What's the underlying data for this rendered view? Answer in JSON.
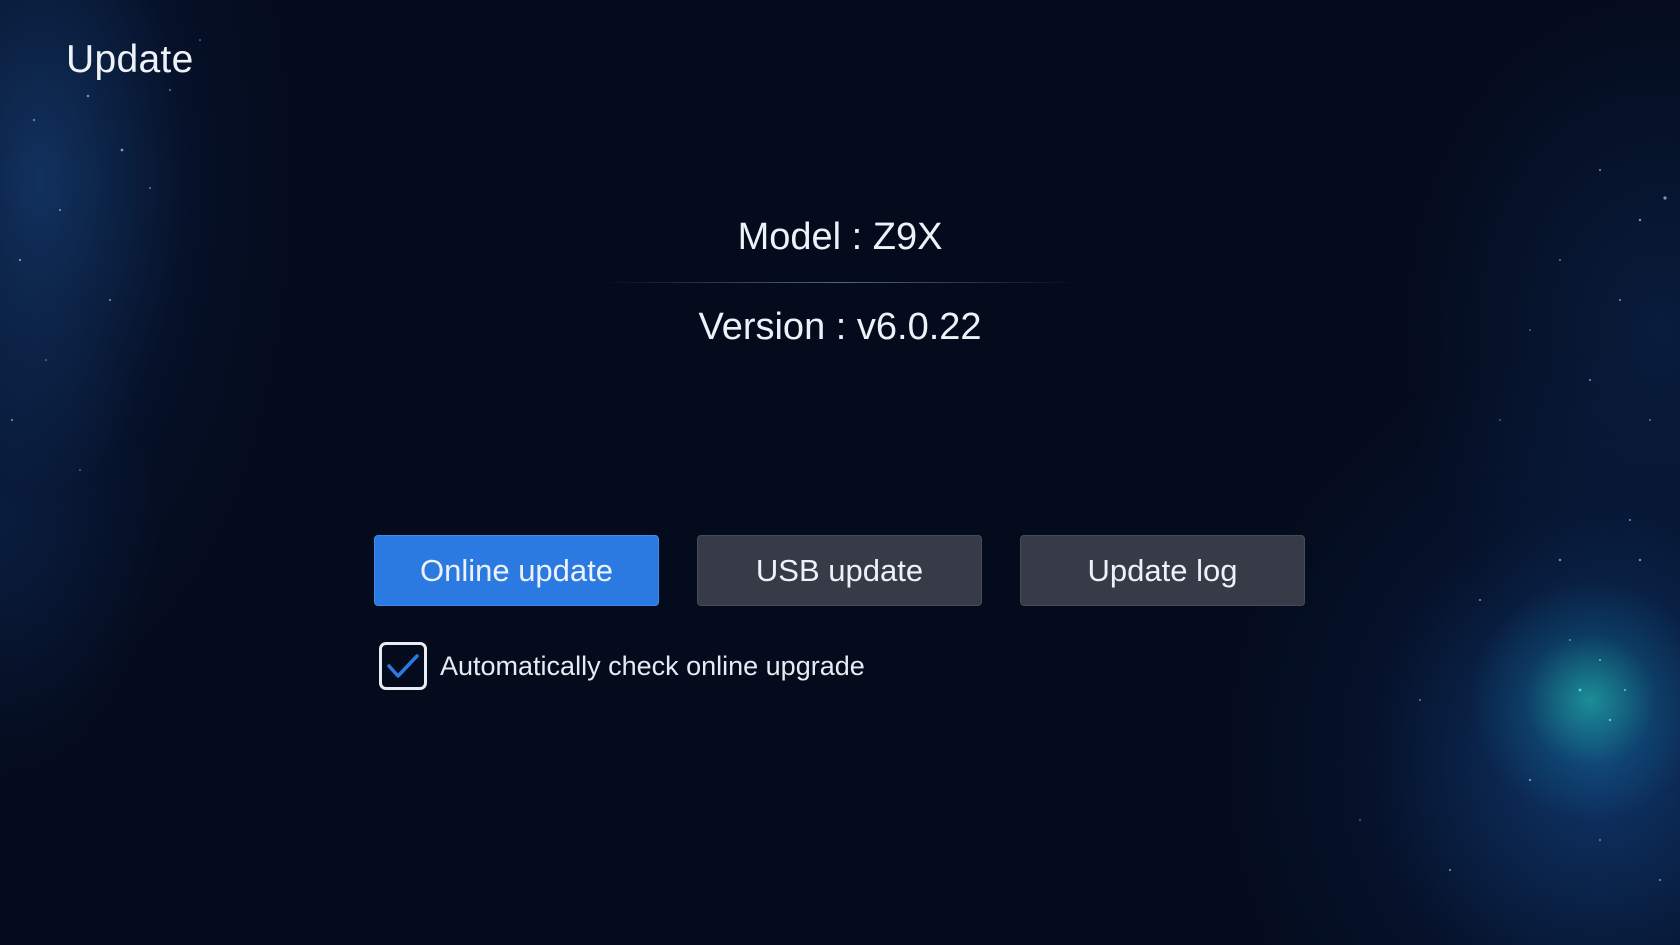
{
  "header": {
    "title": "Update"
  },
  "device": {
    "model_text": "Model : Z9X",
    "version_text": "Version : v6.0.22"
  },
  "actions": {
    "online_update_label": "Online update",
    "usb_update_label": "USB update",
    "update_log_label": "Update log",
    "selected": "online_update"
  },
  "auto_check": {
    "label": "Automatically check online upgrade",
    "checked": true
  },
  "colors": {
    "background": "#040b1c",
    "accent": "#2a7ae2",
    "button": "#363b47",
    "check": "#2a7ae2",
    "text": "#eef2f8"
  },
  "icons": {
    "checkbox_mark": "checkmark-icon"
  }
}
